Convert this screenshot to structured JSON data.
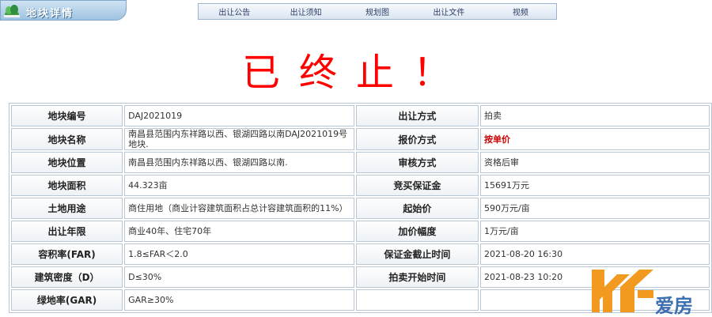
{
  "header": {
    "title": "地块详情"
  },
  "nav": {
    "items": [
      "出让公告",
      "出让须知",
      "规划图",
      "出让文件",
      "视频"
    ]
  },
  "status": {
    "text": "已终止！"
  },
  "rows": [
    {
      "left_label": "地块编号",
      "left_value": "DAJ2021019",
      "right_label": "出让方式",
      "right_value": "拍卖"
    },
    {
      "left_label": "地块名称",
      "left_value": "南昌县范围内东祥路以西、银湖四路以南DAJ2021019号地块.",
      "right_label": "报价方式",
      "right_value": "按单价"
    },
    {
      "left_label": "地块位置",
      "left_value": "南昌县范围内东祥路以西、银湖四路以南.",
      "right_label": "审核方式",
      "right_value": "资格后审"
    },
    {
      "left_label": "地块面积",
      "left_value": "44.323亩",
      "right_label": "竞买保证金",
      "right_value": "15691万元"
    },
    {
      "left_label": "土地用途",
      "left_value": "商住用地（商业计容建筑面积占总计容建筑面积的11%）",
      "right_label": "起始价",
      "right_value": "590万元/亩"
    },
    {
      "left_label": "出让年限",
      "left_value": "商业40年、住宅70年",
      "right_label": "加价幅度",
      "right_value": "1万元/亩"
    },
    {
      "left_label": "容积率(FAR)",
      "left_value": "1.8≤FAR＜2.0",
      "right_label": "保证金截止时间",
      "right_value": "2021-08-20 16:30"
    },
    {
      "left_label": "建筑密度（D）",
      "left_value": "D≤30%",
      "right_label": "拍卖开始时间",
      "right_value": "2021-08-23 10:20"
    },
    {
      "left_label": "绿地率(GAR)",
      "left_value": "GAR≥30%"
    }
  ],
  "watermark": {
    "text": "爱房"
  },
  "colors": {
    "status_red": "#ff0000",
    "quote_red": "#cc0000",
    "watermark_orange": "#f29a1f",
    "watermark_blue": "#3e6fb0"
  }
}
